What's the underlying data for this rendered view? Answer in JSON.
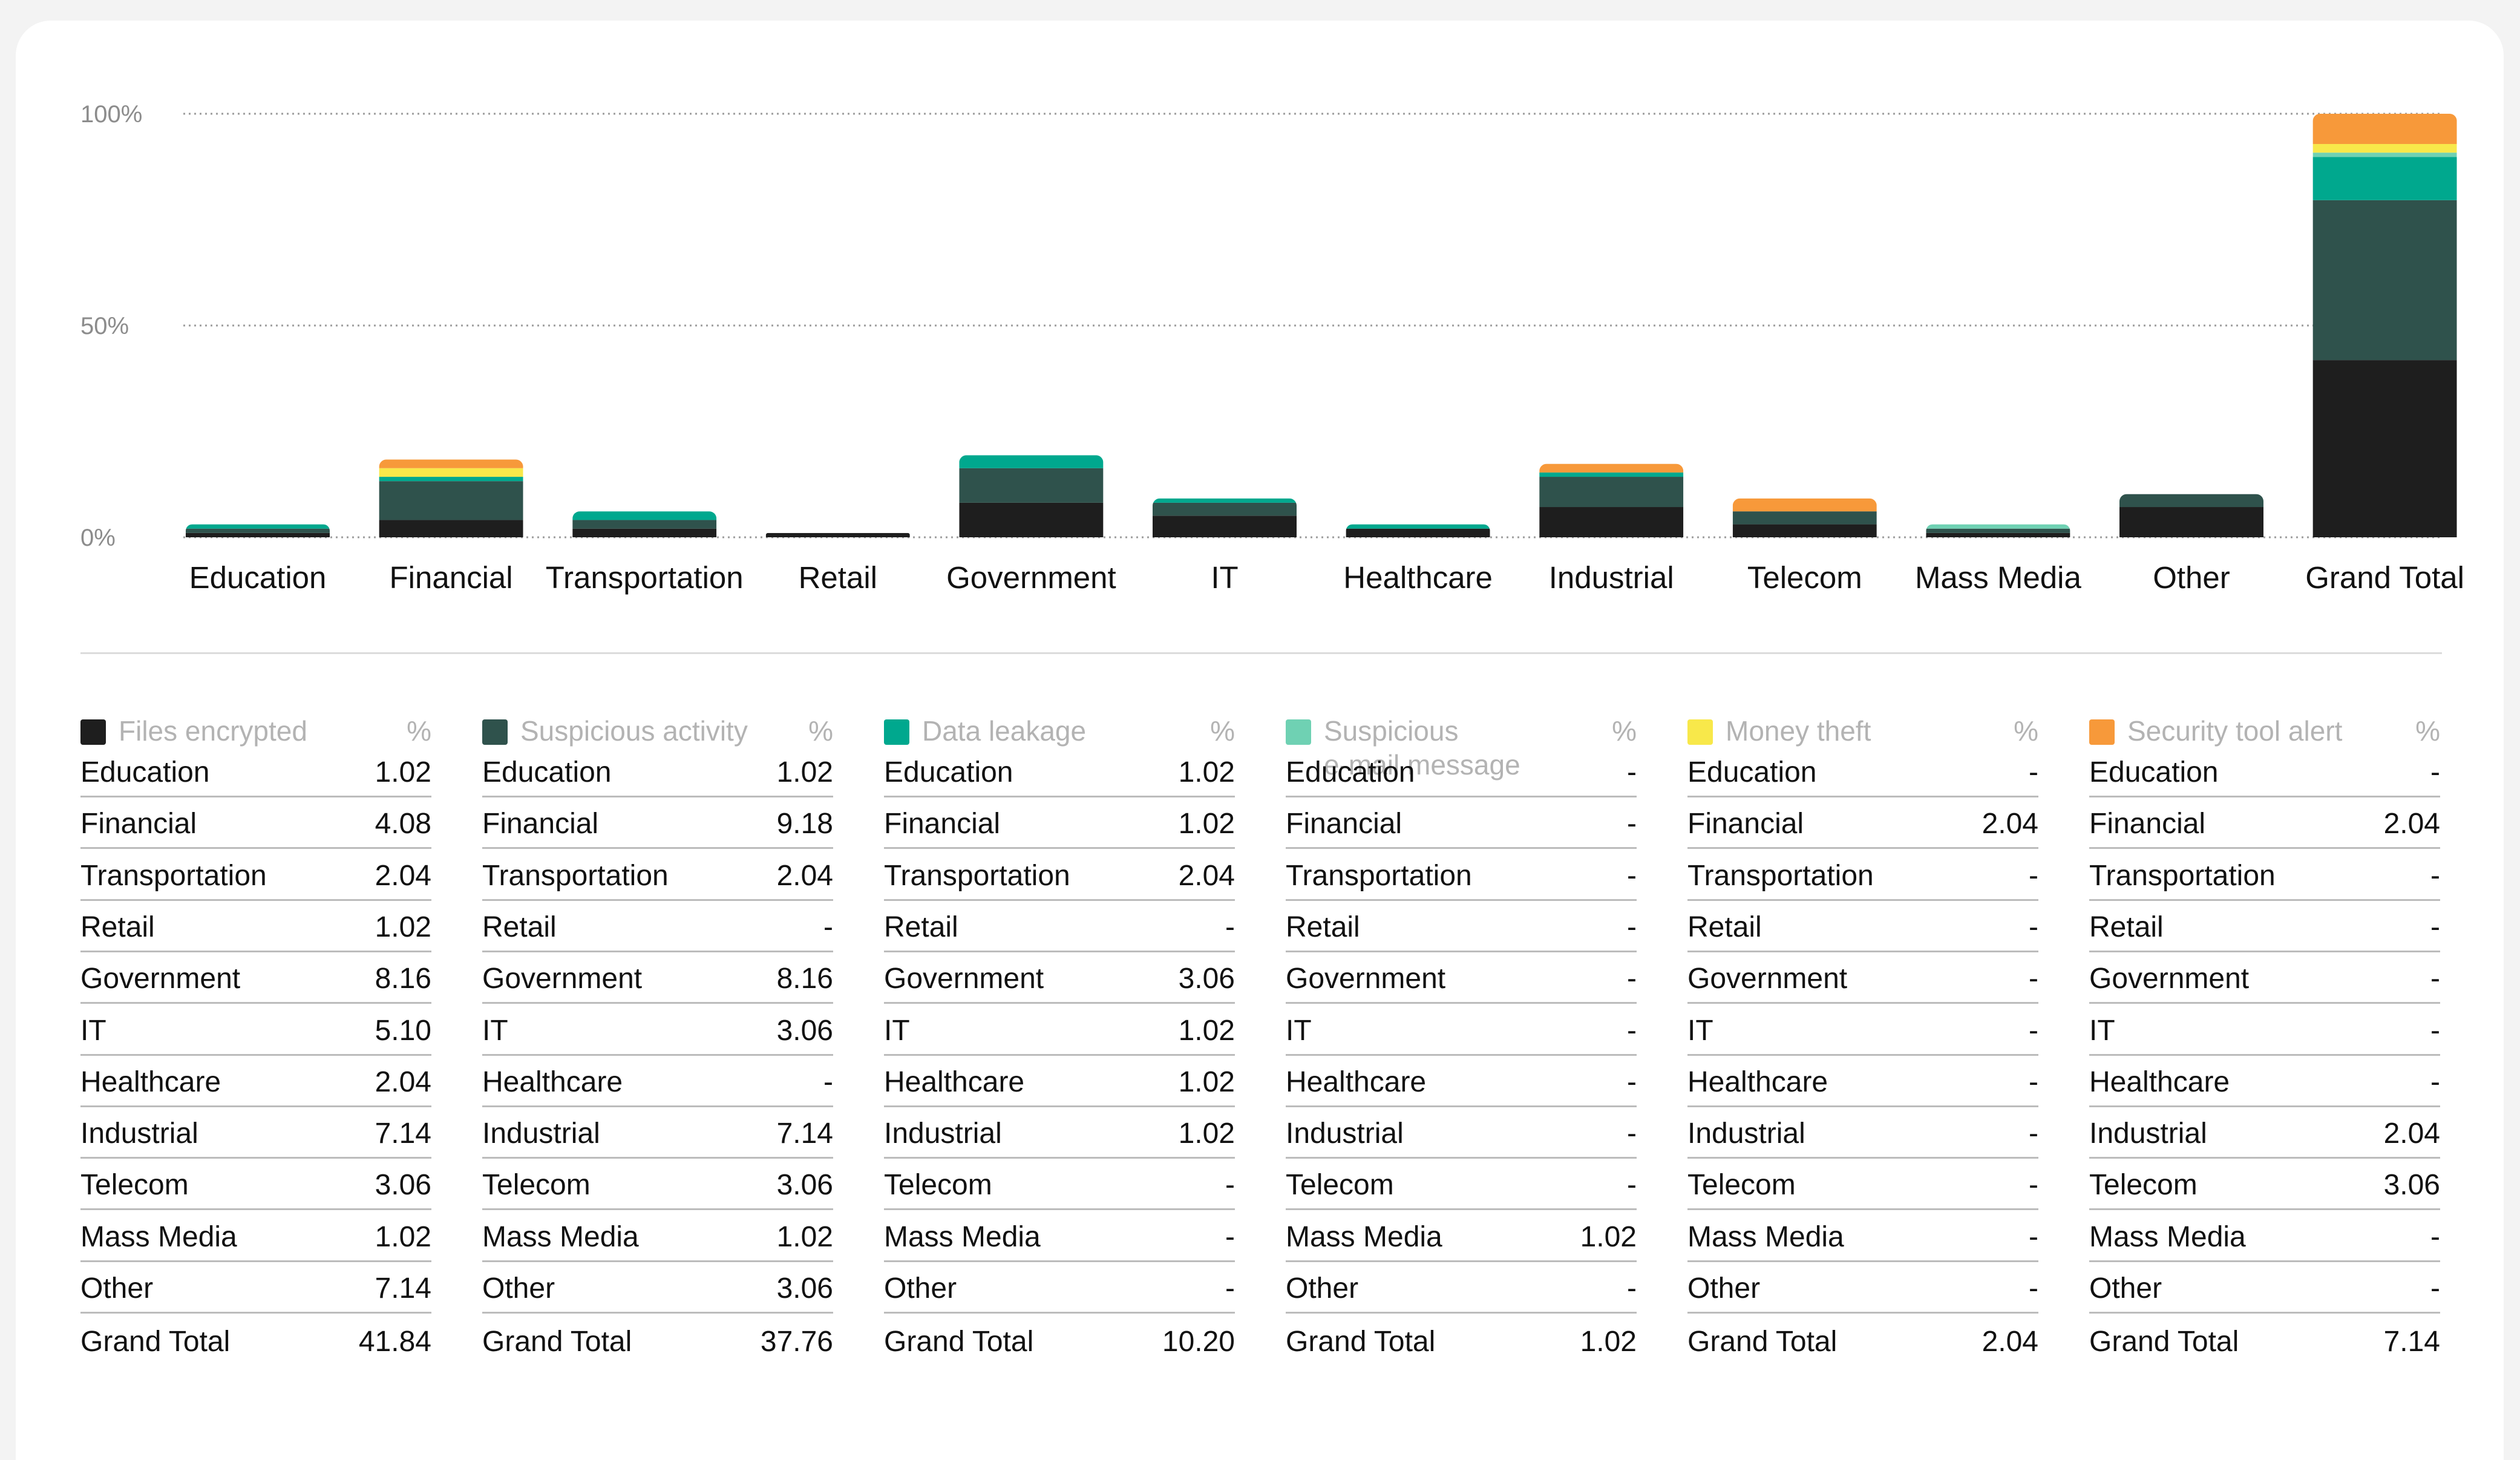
{
  "chart_data": {
    "type": "bar",
    "stacked": true,
    "yticks": [
      "100%",
      "50%",
      "0%"
    ],
    "ylim": [
      0,
      100
    ],
    "grid": true,
    "categories": [
      "Education",
      "Financial",
      "Transportation",
      "Retail",
      "Government",
      "IT",
      "Healthcare",
      "Industrial",
      "Telecom",
      "Mass Media",
      "Other",
      "Grand Total"
    ],
    "series": [
      {
        "name": "Files encrypted",
        "color": "#1e1e1e",
        "values": [
          1.02,
          4.08,
          2.04,
          1.02,
          8.16,
          5.1,
          2.04,
          7.14,
          3.06,
          1.02,
          7.14,
          41.84
        ]
      },
      {
        "name": "Suspicious activity",
        "color": "#2f524c",
        "values": [
          1.02,
          9.18,
          2.04,
          null,
          8.16,
          3.06,
          null,
          7.14,
          3.06,
          1.02,
          3.06,
          37.76
        ]
      },
      {
        "name": "Data leakage",
        "color": "#00a88e",
        "values": [
          1.02,
          1.02,
          2.04,
          null,
          3.06,
          1.02,
          1.02,
          1.02,
          null,
          null,
          null,
          10.2
        ]
      },
      {
        "name": "Suspicious\ne-mail message",
        "color": "#6fd1b3",
        "values": [
          null,
          null,
          null,
          null,
          null,
          null,
          null,
          null,
          null,
          1.02,
          null,
          1.02
        ]
      },
      {
        "name": "Money theft",
        "color": "#f8e84a",
        "values": [
          null,
          2.04,
          null,
          null,
          null,
          null,
          null,
          null,
          null,
          null,
          null,
          2.04
        ]
      },
      {
        "name": "Security tool alert",
        "color": "#f7993a",
        "values": [
          null,
          2.04,
          null,
          null,
          null,
          null,
          null,
          2.04,
          3.06,
          null,
          null,
          7.14
        ]
      }
    ]
  },
  "table": {
    "pct_symbol": "%",
    "empty_symbol": "-"
  }
}
